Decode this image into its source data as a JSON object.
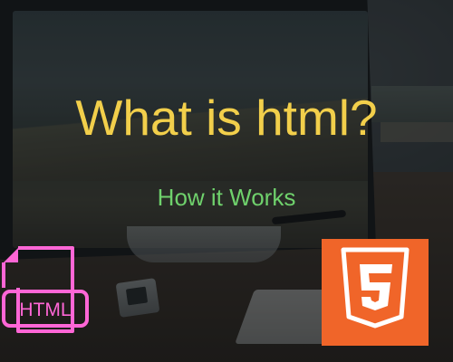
{
  "headline": "What is html?",
  "subheadline": "How it Works",
  "file_icon_label": "HTML",
  "colors": {
    "headline": "#f2cf4b",
    "subheadline": "#6fd16c",
    "file_icon": "#ff66d6",
    "html5_badge": "#f06529"
  },
  "icons": [
    "html-file-icon",
    "html5-logo-icon"
  ]
}
